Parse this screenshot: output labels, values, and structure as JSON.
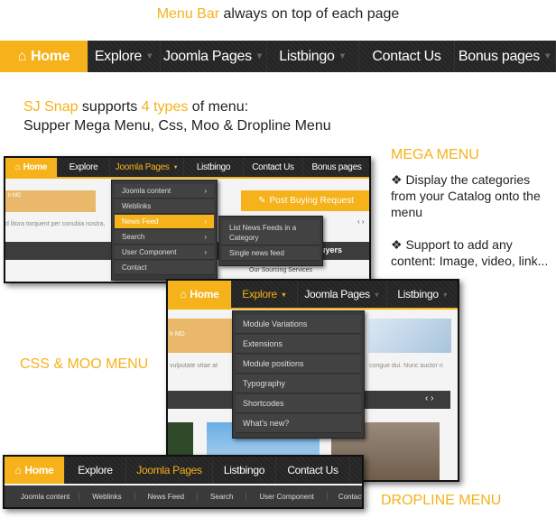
{
  "title": {
    "highlight": "Menu Bar",
    "rest": " always  on top of each page"
  },
  "main_nav": {
    "items": [
      "Home",
      "Explore",
      "Joomla Pages",
      "Listbingo",
      "Contact Us",
      "Bonus pages"
    ]
  },
  "intro": {
    "brand": "SJ Snap",
    "t1": " supports ",
    "count": "4 types",
    "t2": " of menu:",
    "line2": "Supper Mega Menu, Css, Moo  & Dropline Menu"
  },
  "mega": {
    "heading": "MEGA MENU",
    "bullet1": "❖    Display the categories from your Catalog onto the menu",
    "bullet2": "❖    Support to add any content: Image, video, link...",
    "nav": [
      "Home",
      "Explore",
      "Joomla Pages",
      "Listbingo",
      "Contact Us",
      "Bonus pages"
    ],
    "dropdown": [
      "Joomla content",
      "Weblinks",
      "News Feed",
      "Search",
      "User Component",
      "Contact"
    ],
    "submenu": [
      "List News Feeds in a Category",
      "Single news feed"
    ],
    "button": "Post Buying Request",
    "bg_text": "d litora torquent per conubia nostra,",
    "buyers": "uyers",
    "sourcing": "Our Sourcing Services",
    "logo_text": "h MD"
  },
  "css_moo": {
    "heading": "CSS & MOO MENU",
    "nav": [
      "Home",
      "Explore",
      "Joomla Pages",
      "Listbingo"
    ],
    "dropdown": [
      "Module Variations",
      "Extensions",
      "Module positions",
      "Typography",
      "Shortcodes",
      "What's new?"
    ],
    "bg_text_left": "vulputate vitae at",
    "bg_text_right": "congue dui. Nunc auctor n",
    "logo_text": "h MD"
  },
  "dropline": {
    "heading": "DROPLINE MENU",
    "nav": [
      "Home",
      "Explore",
      "Joomla Pages",
      "Listbingo",
      "Contact Us"
    ],
    "subnav": [
      "Joomla content",
      "Weblinks",
      "News Feed",
      "Search",
      "User Component",
      "Contact"
    ]
  },
  "colors": {
    "accent": "#f5b21a",
    "bar": "#262626"
  }
}
